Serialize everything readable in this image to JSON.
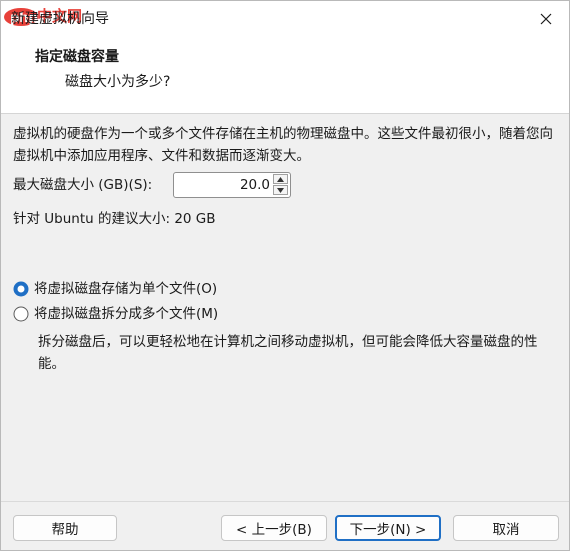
{
  "window": {
    "title": "新建虚拟机向导",
    "watermark": "php中文网"
  },
  "header": {
    "title": "指定磁盘容量",
    "subtitle": "磁盘大小为多少?"
  },
  "body": {
    "description": "虚拟机的硬盘作为一个或多个文件存储在主机的物理磁盘中。这些文件最初很小，随着您向虚拟机中添加应用程序、文件和数据而逐渐变大。",
    "size_label": "最大磁盘大小 (GB)(S):",
    "size_value": "20.0",
    "recommended": "针对 Ubuntu 的建议大小: 20 GB",
    "options": [
      {
        "label": "将虚拟磁盘存储为单个文件(O)",
        "selected": true
      },
      {
        "label": "将虚拟磁盘拆分成多个文件(M)",
        "selected": false
      }
    ],
    "split_note": "拆分磁盘后，可以更轻松地在计算机之间移动虚拟机，但可能会降低大容量磁盘的性能。"
  },
  "footer": {
    "help": "帮助",
    "back": "< 上一步(B)",
    "next": "下一步(N) >",
    "cancel": "取消"
  },
  "colors": {
    "accent": "#1f6fc5",
    "watermark": "#e8413a"
  }
}
